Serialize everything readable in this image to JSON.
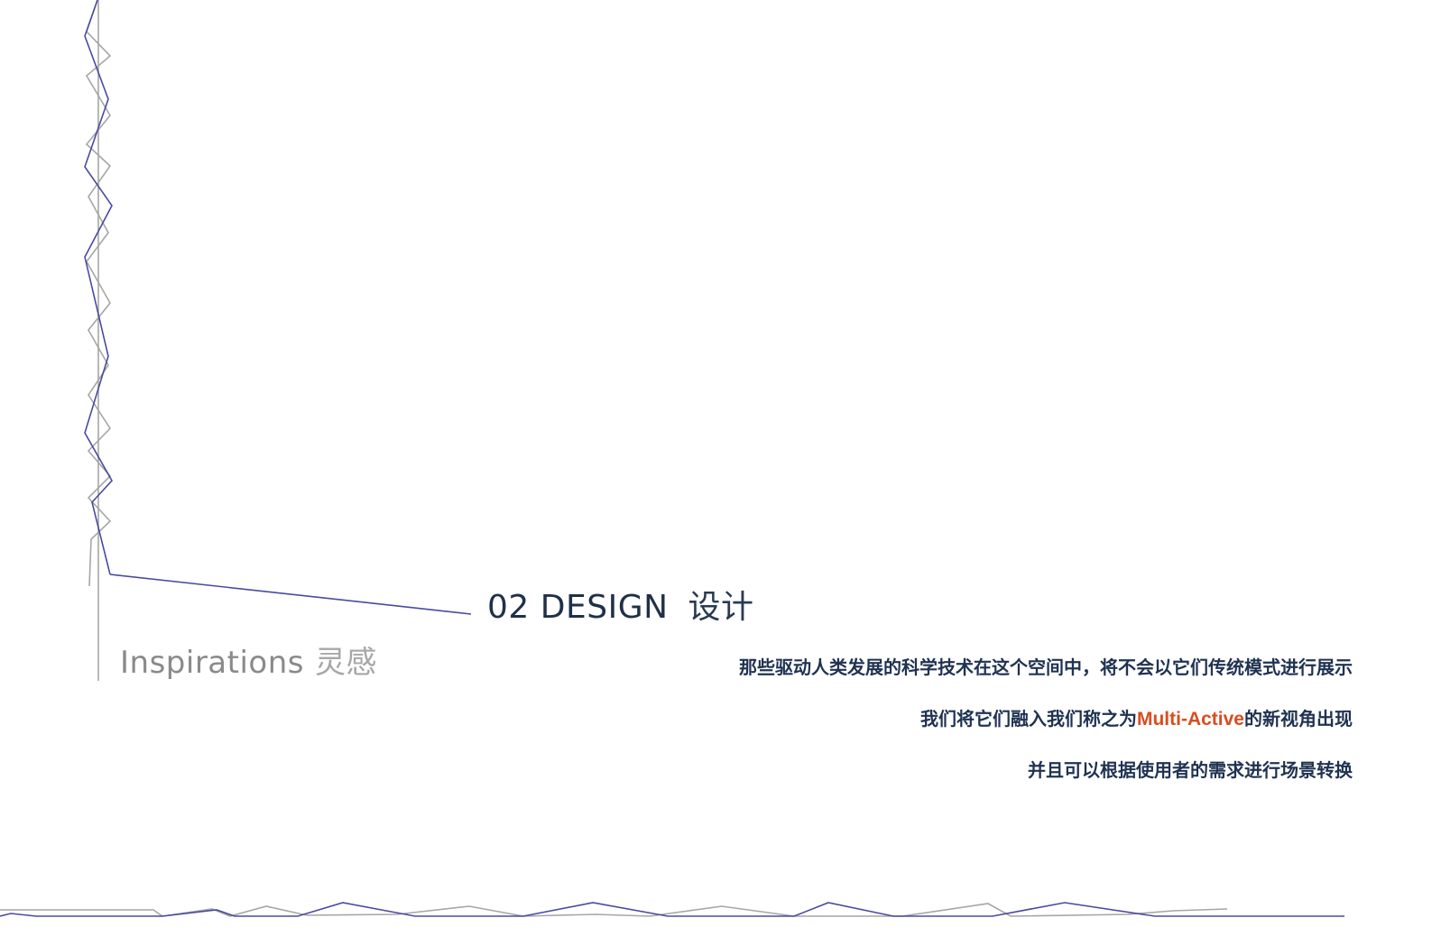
{
  "heading": {
    "number_title": "02 DESIGN",
    "chinese": "设计"
  },
  "subheading": {
    "english": "Inspirations",
    "chinese": "灵感"
  },
  "body": {
    "line1": "那些驱动人类发展的科学技术在这个空间中，将不会以它们传统模式进行展示",
    "line2_before": "我们将它们融入我们称之为",
    "line2_highlight": "Multi-Active",
    "line2_after": "的新视角出现",
    "line3": "并且可以根据使用者的需求进行场景转换"
  },
  "colors": {
    "accent_line": "#4a4aa0",
    "gray_line": "#a6a6a6",
    "heading": "#1f3049",
    "body_text": "#1f3251",
    "highlight": "#d84d1f"
  }
}
